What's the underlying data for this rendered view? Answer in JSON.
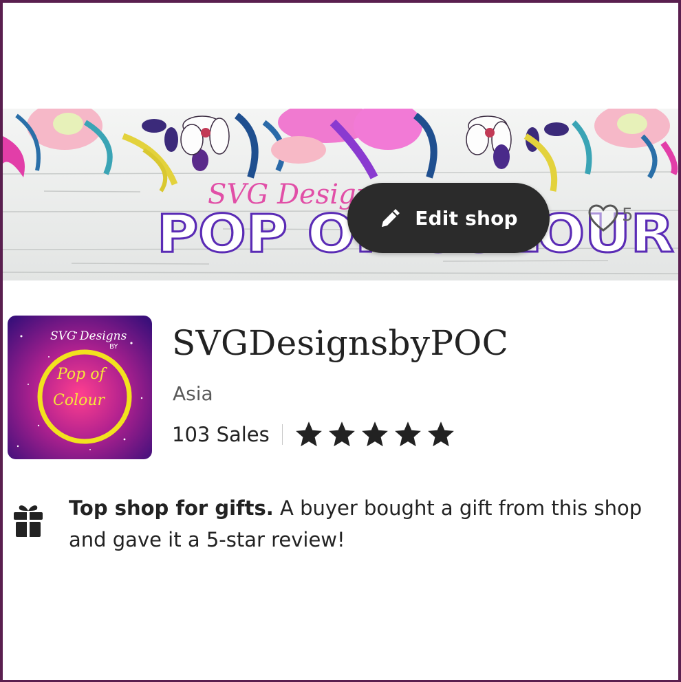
{
  "banner": {
    "script_title": "SVG Designs",
    "main_title": "POP OF COLOUR"
  },
  "edit_shop": {
    "label": "Edit shop",
    "icon": "pencil-icon"
  },
  "favorites": {
    "icon": "heart-outline-icon",
    "count": "5"
  },
  "logo": {
    "line1": "SVG Designs",
    "line2": "BY",
    "line3": "Pop of",
    "line4": "Colour"
  },
  "shop": {
    "name": "SVGDesignsbyPOC",
    "location": "Asia",
    "sales": "103 Sales",
    "rating": 5,
    "max_rating": 5
  },
  "badge": {
    "icon": "gift-icon",
    "title": "Top shop for gifts.",
    "text": "A buyer bought a gift from this shop and gave it a 5-star review!"
  },
  "colors": {
    "edit_button_bg": "#2b2b2b",
    "title_outline": "#5a2bb5",
    "frame": "#5a1f4f",
    "star": "#222222"
  }
}
